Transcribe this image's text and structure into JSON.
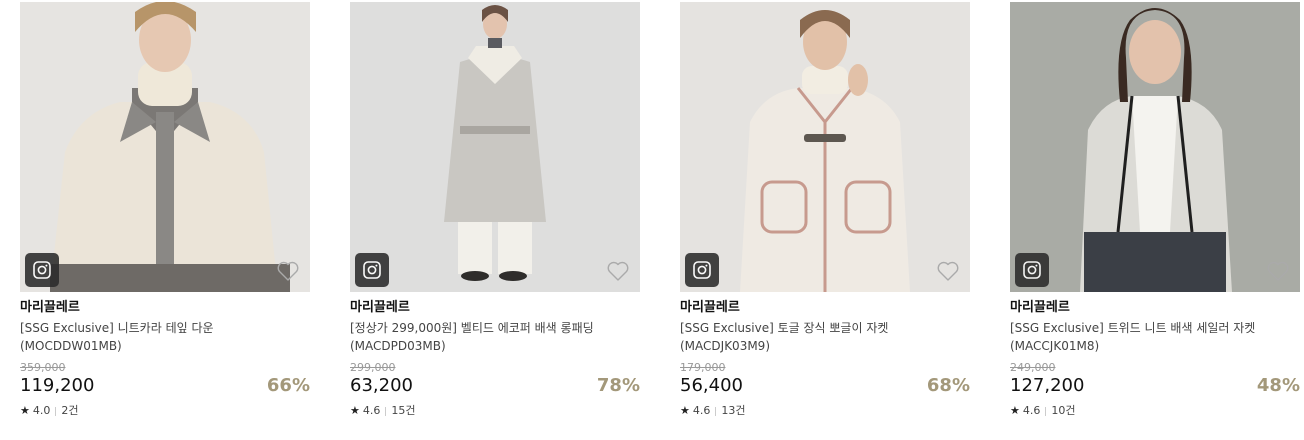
{
  "products": [
    {
      "brand": "마리끌레르",
      "name": "[SSG Exclusive] 니트카라 테잎 다운 (MOCDDW01MB)",
      "original_price": "359,000",
      "price": "119,200",
      "discount": "66%",
      "rating": "4.0",
      "reviews": "2건",
      "icons": {
        "insta": "instagram-icon",
        "heart": "heart-icon",
        "star": "star-icon"
      }
    },
    {
      "brand": "마리끌레르",
      "name": "[정상가 299,000원] 벨티드 에코퍼 배색 롱패딩 (MACDPD03MB)",
      "original_price": "299,000",
      "price": "63,200",
      "discount": "78%",
      "rating": "4.6",
      "reviews": "15건",
      "icons": {
        "insta": "instagram-icon",
        "heart": "heart-icon",
        "star": "star-icon"
      }
    },
    {
      "brand": "마리끌레르",
      "name": "[SSG Exclusive] 토글 장식 뽀글이 자켓 (MACDJK03M9)",
      "original_price": "179,000",
      "price": "56,400",
      "discount": "68%",
      "rating": "4.6",
      "reviews": "13건",
      "icons": {
        "insta": "instagram-icon",
        "heart": "heart-icon",
        "star": "star-icon"
      }
    },
    {
      "brand": "마리끌레르",
      "name": "[SSG Exclusive] 트위드 니트 배색 세일러 자켓 (MACCJK01M8)",
      "original_price": "249,000",
      "price": "127,200",
      "discount": "48%",
      "rating": "4.6",
      "reviews": "10건",
      "icons": {
        "insta": "instagram-icon",
        "heart": "heart-icon",
        "star": "star-icon"
      }
    }
  ],
  "colors": {
    "discount": "#a3987a",
    "original_price": "#999999",
    "price": "#111111"
  }
}
